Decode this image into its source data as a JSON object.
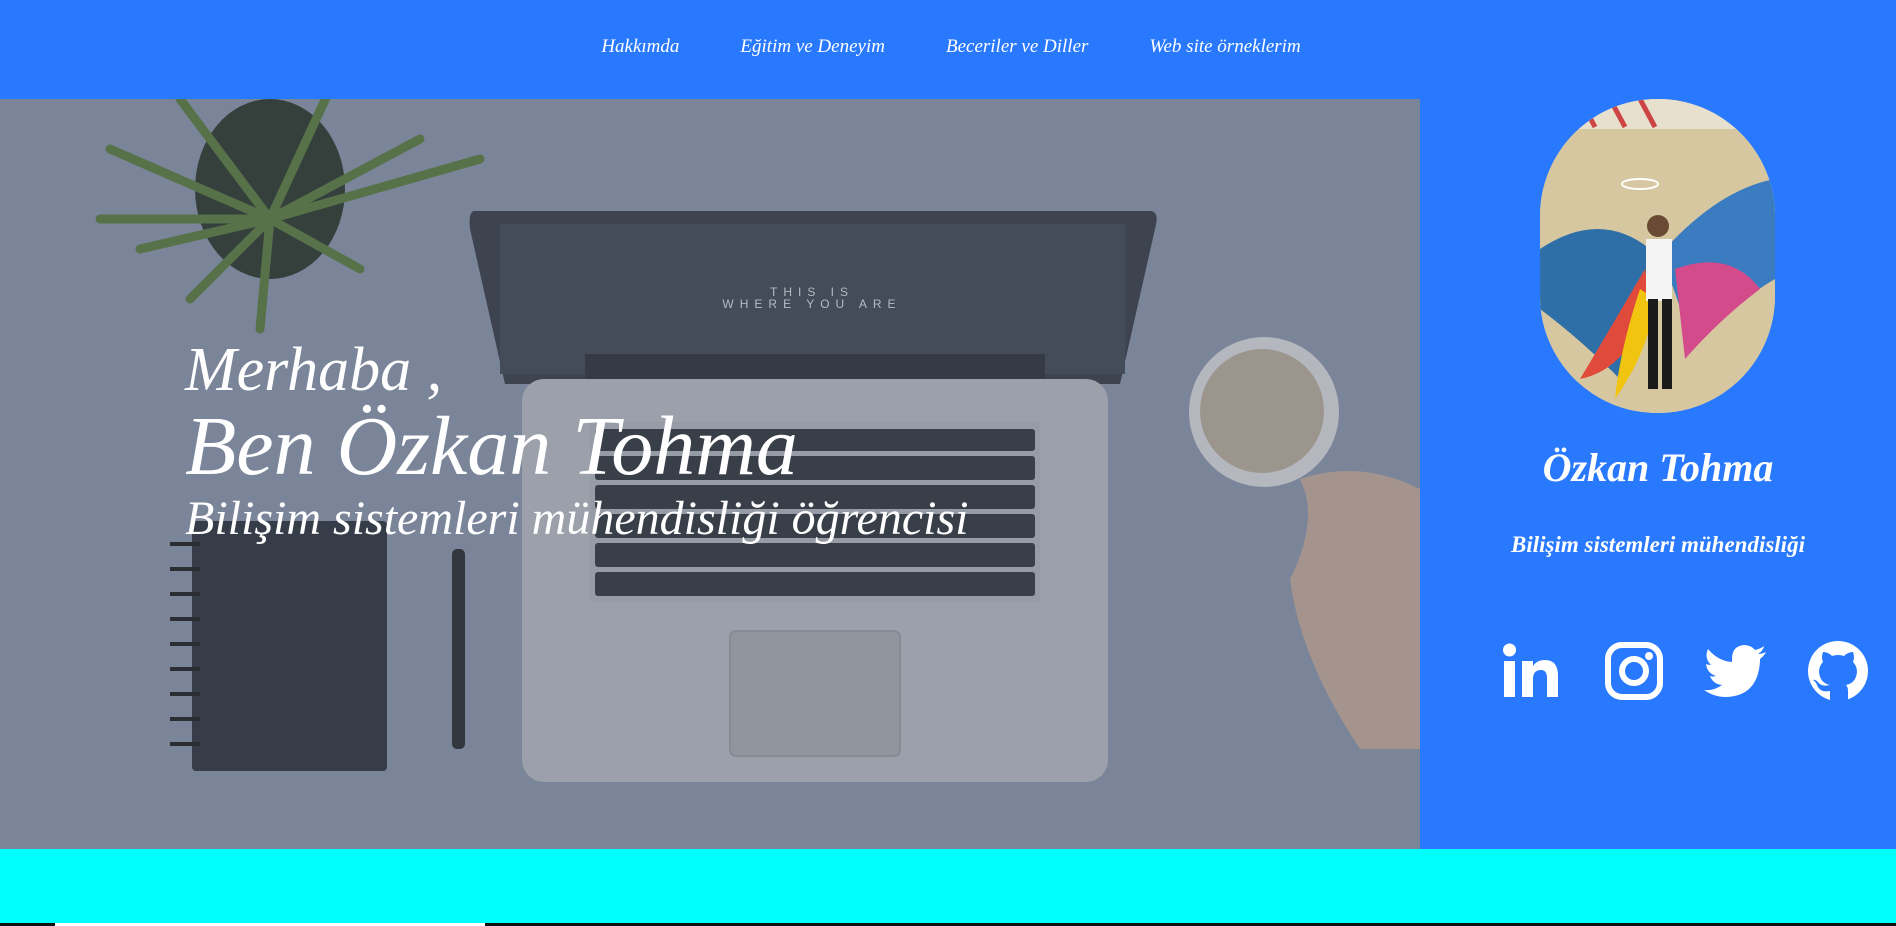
{
  "nav": {
    "items": [
      {
        "label": "Hakkımda"
      },
      {
        "label": "Eğitim ve Deneyim"
      },
      {
        "label": "Beceriler ve Diller"
      },
      {
        "label": "Web site örneklerim"
      }
    ]
  },
  "hero": {
    "greeting": "Merhaba ,",
    "name": "Ben Özkan Tohma",
    "role": "Bilişim sistemleri mühendisliği öğrencisi",
    "laptop_screen_text_1": "THIS IS",
    "laptop_screen_text_2": "WHERE YOU ARE"
  },
  "sidebar": {
    "name": "Özkan Tohma",
    "role": "Bilişim sistemleri mühendisliği",
    "socials": [
      {
        "icon": "linkedin-icon"
      },
      {
        "icon": "instagram-icon"
      },
      {
        "icon": "twitter-icon"
      },
      {
        "icon": "github-icon"
      }
    ]
  },
  "colors": {
    "primary": "#2979ff",
    "band": "#00ffff",
    "text": "#ffffff"
  }
}
